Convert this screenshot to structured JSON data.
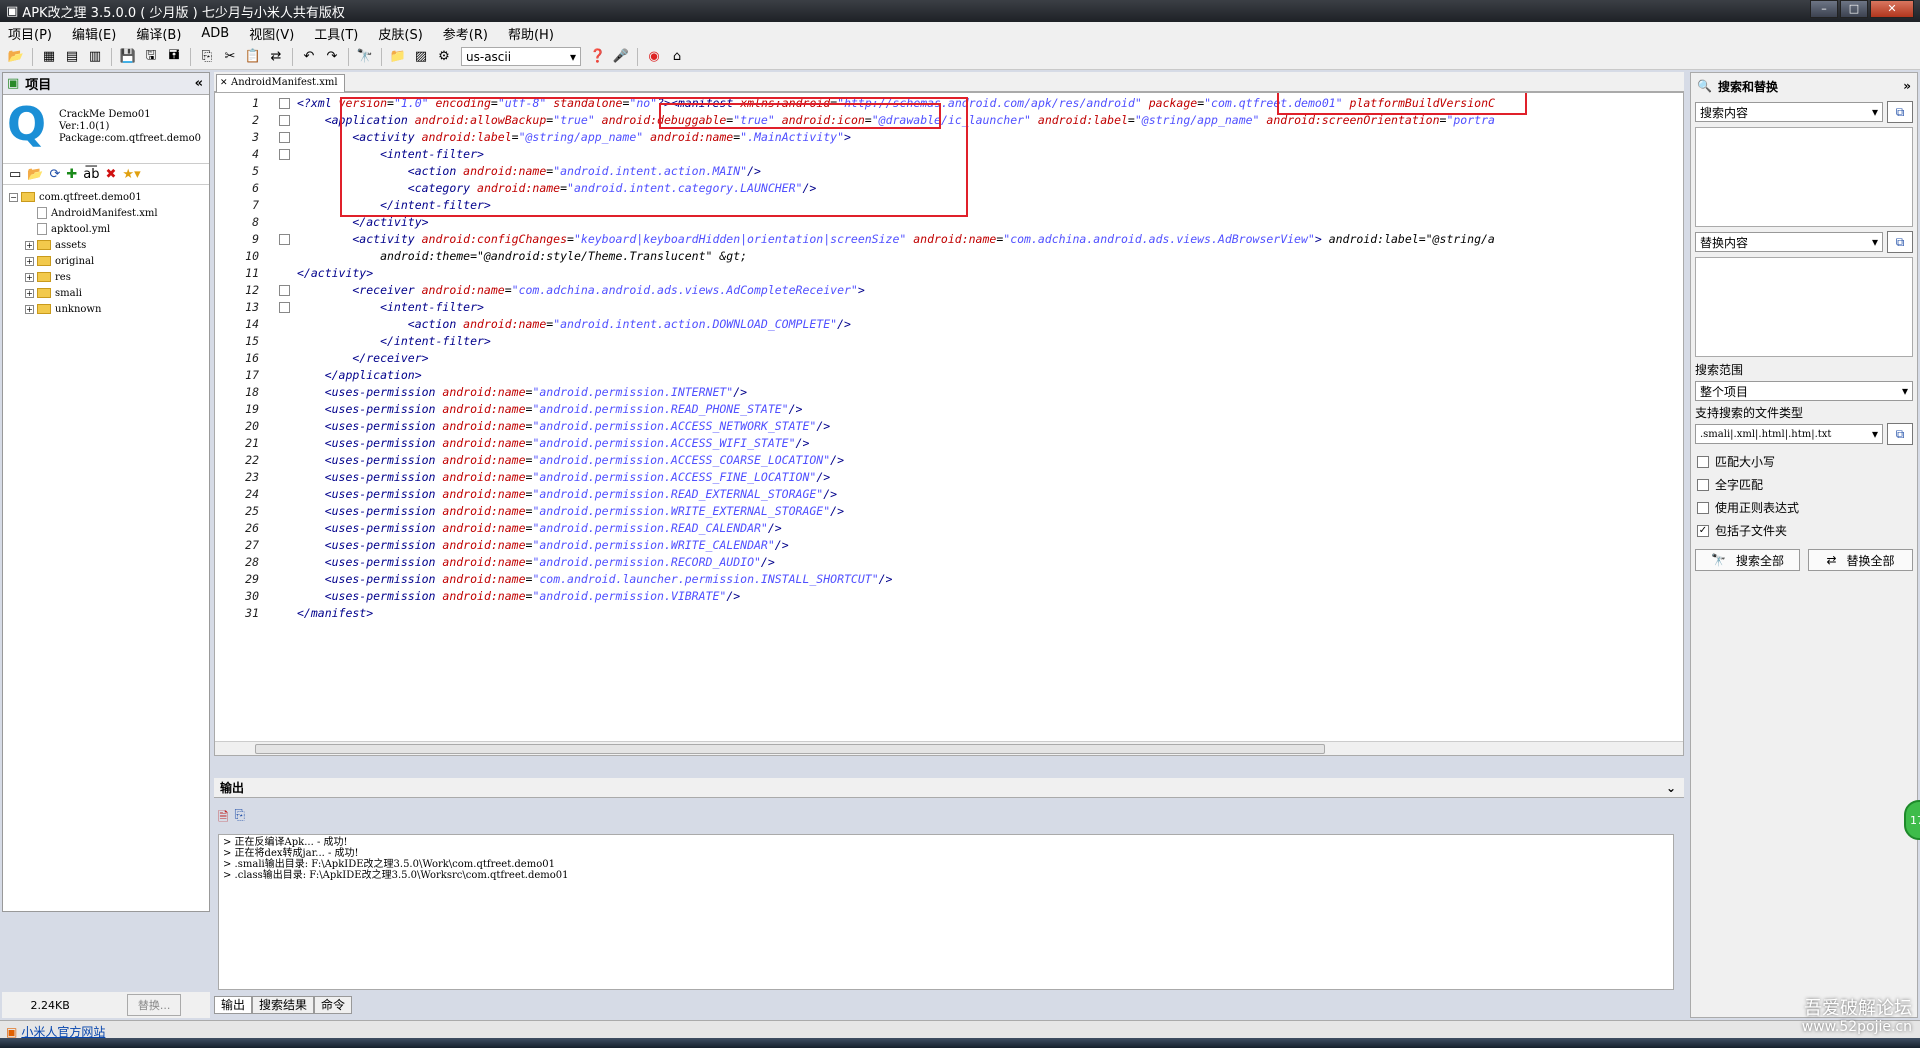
{
  "window": {
    "title": "APK改之理 3.5.0.0 ( 少月版 ) 七少月与小米人共有版权"
  },
  "menu": [
    "项目(P)",
    "编辑(E)",
    "编译(B)",
    "ADB",
    "视图(V)",
    "工具(T)",
    "皮肤(S)",
    "参考(R)",
    "帮助(H)"
  ],
  "toolbar": {
    "encoding": "us-ascii"
  },
  "project_panel": {
    "title": "项目",
    "info": [
      "CrackMe Demo01",
      "Ver:1.0(1)",
      "Package:com.qtfreet.demo0"
    ],
    "tree": [
      {
        "label": "com.qtfreet.demo01",
        "type": "root",
        "level": 0
      },
      {
        "label": "AndroidManifest.xml",
        "type": "file",
        "level": 1
      },
      {
        "label": "apktool.yml",
        "type": "file",
        "level": 1
      },
      {
        "label": "assets",
        "type": "folder",
        "level": 1
      },
      {
        "label": "original",
        "type": "folder",
        "level": 1
      },
      {
        "label": "res",
        "type": "folder",
        "level": 1
      },
      {
        "label": "smali",
        "type": "folder",
        "level": 1
      },
      {
        "label": "unknown",
        "type": "folder",
        "level": 1
      }
    ],
    "size": "2.24KB",
    "replace_button": "替换..."
  },
  "editor": {
    "tab": "AndroidManifest.xml",
    "lines": [
      {
        "n": "1",
        "fold": true,
        "tokens": [
          [
            "tag",
            "<?xml "
          ],
          [
            "attr",
            "version"
          ],
          [
            "plain",
            "="
          ],
          [
            "val",
            "\"1.0\" "
          ],
          [
            "attr",
            "encoding"
          ],
          [
            "plain",
            "="
          ],
          [
            "val",
            "\"utf-8\" "
          ],
          [
            "attr",
            "standalone"
          ],
          [
            "plain",
            "="
          ],
          [
            "val",
            "\"no\""
          ],
          [
            "tag",
            "?><manifest "
          ],
          [
            "attr",
            "xmlns:android"
          ],
          [
            "plain",
            "="
          ],
          [
            "val",
            "\"http://schemas.android.com/apk/res/android\" "
          ],
          [
            "attr",
            "package"
          ],
          [
            "plain",
            "="
          ],
          [
            "val",
            "\"com.qtfreet.demo01\" "
          ],
          [
            "attr",
            "platformBuildVersionC"
          ]
        ]
      },
      {
        "n": "2",
        "fold": true,
        "tokens": [
          [
            "tag",
            "    <application "
          ],
          [
            "attr",
            "android:allowBackup"
          ],
          [
            "plain",
            "="
          ],
          [
            "val",
            "\"true\" "
          ],
          [
            "attr",
            "android:debuggable"
          ],
          [
            "plain",
            "="
          ],
          [
            "val",
            "\"true\" "
          ],
          [
            "attr",
            "android:icon"
          ],
          [
            "plain",
            "="
          ],
          [
            "val",
            "\"@drawable/ic_launcher\" "
          ],
          [
            "attr",
            "android:label"
          ],
          [
            "plain",
            "="
          ],
          [
            "val",
            "\"@string/app_name\" "
          ],
          [
            "attr",
            "android:screenOrientation"
          ],
          [
            "plain",
            "="
          ],
          [
            "val",
            "\"portra"
          ]
        ]
      },
      {
        "n": "3",
        "fold": true,
        "tokens": [
          [
            "tag",
            "        <activity "
          ],
          [
            "attr",
            "android:label"
          ],
          [
            "plain",
            "="
          ],
          [
            "val",
            "\"@string/app_name\" "
          ],
          [
            "attr",
            "android:name"
          ],
          [
            "plain",
            "="
          ],
          [
            "val",
            "\".MainActivity\""
          ],
          [
            "tag",
            ">"
          ]
        ]
      },
      {
        "n": "4",
        "fold": true,
        "tokens": [
          [
            "tag",
            "            <intent-filter>"
          ]
        ]
      },
      {
        "n": "5",
        "fold": false,
        "tokens": [
          [
            "tag",
            "                <action "
          ],
          [
            "attr",
            "android:name"
          ],
          [
            "plain",
            "="
          ],
          [
            "val",
            "\"android.intent.action.MAIN\""
          ],
          [
            "tag",
            "/>"
          ]
        ]
      },
      {
        "n": "6",
        "fold": false,
        "tokens": [
          [
            "tag",
            "                <category "
          ],
          [
            "attr",
            "android:name"
          ],
          [
            "plain",
            "="
          ],
          [
            "val",
            "\"android.intent.category.LAUNCHER\""
          ],
          [
            "tag",
            "/>"
          ]
        ]
      },
      {
        "n": "7",
        "fold": false,
        "tokens": [
          [
            "tag",
            "            </intent-filter>"
          ]
        ]
      },
      {
        "n": "8",
        "fold": false,
        "tokens": [
          [
            "tag",
            "        </activity>"
          ]
        ]
      },
      {
        "n": "9",
        "fold": true,
        "tokens": [
          [
            "tag",
            "        <activity "
          ],
          [
            "attr",
            "android:configChanges"
          ],
          [
            "plain",
            "="
          ],
          [
            "val",
            "\"keyboard|keyboardHidden|orientation|screenSize\" "
          ],
          [
            "attr",
            "android:name"
          ],
          [
            "plain",
            "="
          ],
          [
            "val",
            "\"com.adchina.android.ads.views.AdBrowserView\""
          ],
          [
            "tag",
            "> "
          ],
          [
            "plain",
            "android:label=\"@string/a"
          ]
        ]
      },
      {
        "n": "10",
        "fold": false,
        "tokens": [
          [
            "plain",
            "            android:theme=\"@android:style/Theme.Translucent\" &gt;"
          ]
        ]
      },
      {
        "n": "11",
        "fold": false,
        "tokens": [
          [
            "tag",
            "</activity>"
          ]
        ]
      },
      {
        "n": "12",
        "fold": true,
        "tokens": [
          [
            "tag",
            "        <receiver "
          ],
          [
            "attr",
            "android:name"
          ],
          [
            "plain",
            "="
          ],
          [
            "val",
            "\"com.adchina.android.ads.views.AdCompleteReceiver\""
          ],
          [
            "tag",
            ">"
          ]
        ]
      },
      {
        "n": "13",
        "fold": true,
        "tokens": [
          [
            "tag",
            "            <intent-filter>"
          ]
        ]
      },
      {
        "n": "14",
        "fold": false,
        "tokens": [
          [
            "tag",
            "                <action "
          ],
          [
            "attr",
            "android:name"
          ],
          [
            "plain",
            "="
          ],
          [
            "val",
            "\"android.intent.action.DOWNLOAD_COMPLETE\""
          ],
          [
            "tag",
            "/>"
          ]
        ]
      },
      {
        "n": "15",
        "fold": false,
        "tokens": [
          [
            "tag",
            "            </intent-filter>"
          ]
        ]
      },
      {
        "n": "16",
        "fold": false,
        "tokens": [
          [
            "tag",
            "        </receiver>"
          ]
        ]
      },
      {
        "n": "17",
        "fold": false,
        "tokens": [
          [
            "tag",
            "    </application>"
          ]
        ]
      },
      {
        "n": "18",
        "fold": false,
        "tokens": [
          [
            "tag",
            "    <uses-permission "
          ],
          [
            "attr",
            "android:name"
          ],
          [
            "plain",
            "="
          ],
          [
            "val",
            "\"android.permission.INTERNET\""
          ],
          [
            "tag",
            "/>"
          ]
        ]
      },
      {
        "n": "19",
        "fold": false,
        "tokens": [
          [
            "tag",
            "    <uses-permission "
          ],
          [
            "attr",
            "android:name"
          ],
          [
            "plain",
            "="
          ],
          [
            "val",
            "\"android.permission.READ_PHONE_STATE\""
          ],
          [
            "tag",
            "/>"
          ]
        ]
      },
      {
        "n": "20",
        "fold": false,
        "tokens": [
          [
            "tag",
            "    <uses-permission "
          ],
          [
            "attr",
            "android:name"
          ],
          [
            "plain",
            "="
          ],
          [
            "val",
            "\"android.permission.ACCESS_NETWORK_STATE\""
          ],
          [
            "tag",
            "/>"
          ]
        ]
      },
      {
        "n": "21",
        "fold": false,
        "tokens": [
          [
            "tag",
            "    <uses-permission "
          ],
          [
            "attr",
            "android:name"
          ],
          [
            "plain",
            "="
          ],
          [
            "val",
            "\"android.permission.ACCESS_WIFI_STATE\""
          ],
          [
            "tag",
            "/>"
          ]
        ]
      },
      {
        "n": "22",
        "fold": false,
        "tokens": [
          [
            "tag",
            "    <uses-permission "
          ],
          [
            "attr",
            "android:name"
          ],
          [
            "plain",
            "="
          ],
          [
            "val",
            "\"android.permission.ACCESS_COARSE_LOCATION\""
          ],
          [
            "tag",
            "/>"
          ]
        ]
      },
      {
        "n": "23",
        "fold": false,
        "tokens": [
          [
            "tag",
            "    <uses-permission "
          ],
          [
            "attr",
            "android:name"
          ],
          [
            "plain",
            "="
          ],
          [
            "val",
            "\"android.permission.ACCESS_FINE_LOCATION\""
          ],
          [
            "tag",
            "/>"
          ]
        ]
      },
      {
        "n": "24",
        "fold": false,
        "tokens": [
          [
            "tag",
            "    <uses-permission "
          ],
          [
            "attr",
            "android:name"
          ],
          [
            "plain",
            "="
          ],
          [
            "val",
            "\"android.permission.READ_EXTERNAL_STORAGE\""
          ],
          [
            "tag",
            "/>"
          ]
        ]
      },
      {
        "n": "25",
        "fold": false,
        "tokens": [
          [
            "tag",
            "    <uses-permission "
          ],
          [
            "attr",
            "android:name"
          ],
          [
            "plain",
            "="
          ],
          [
            "val",
            "\"android.permission.WRITE_EXTERNAL_STORAGE\""
          ],
          [
            "tag",
            "/>"
          ]
        ]
      },
      {
        "n": "26",
        "fold": false,
        "tokens": [
          [
            "tag",
            "    <uses-permission "
          ],
          [
            "attr",
            "android:name"
          ],
          [
            "plain",
            "="
          ],
          [
            "val",
            "\"android.permission.READ_CALENDAR\""
          ],
          [
            "tag",
            "/>"
          ]
        ]
      },
      {
        "n": "27",
        "fold": false,
        "tokens": [
          [
            "tag",
            "    <uses-permission "
          ],
          [
            "attr",
            "android:name"
          ],
          [
            "plain",
            "="
          ],
          [
            "val",
            "\"android.permission.WRITE_CALENDAR\""
          ],
          [
            "tag",
            "/>"
          ]
        ]
      },
      {
        "n": "28",
        "fold": false,
        "tokens": [
          [
            "tag",
            "    <uses-permission "
          ],
          [
            "attr",
            "android:name"
          ],
          [
            "plain",
            "="
          ],
          [
            "val",
            "\"android.permission.RECORD_AUDIO\""
          ],
          [
            "tag",
            "/>"
          ]
        ]
      },
      {
        "n": "29",
        "fold": false,
        "tokens": [
          [
            "tag",
            "    <uses-permission "
          ],
          [
            "attr",
            "android:name"
          ],
          [
            "plain",
            "="
          ],
          [
            "val",
            "\"com.android.launcher.permission.INSTALL_SHORTCUT\""
          ],
          [
            "tag",
            "/>"
          ]
        ]
      },
      {
        "n": "30",
        "fold": false,
        "tokens": [
          [
            "tag",
            "    <uses-permission "
          ],
          [
            "attr",
            "android:name"
          ],
          [
            "plain",
            "="
          ],
          [
            "val",
            "\"android.permission.VIBRATE\""
          ],
          [
            "tag",
            "/>"
          ]
        ]
      },
      {
        "n": "31",
        "fold": false,
        "tokens": [
          [
            "tag",
            "</manifest>"
          ]
        ]
      }
    ]
  },
  "output": {
    "title": "输出",
    "lines": [
      "> 正在反编译Apk...  - 成功!",
      "> 正在将dex转成jar...  - 成功!",
      "> .smali输出目录: F:\\ApkIDE改之理3.5.0\\Work\\com.qtfreet.demo01",
      "> .class输出目录: F:\\ApkIDE改之理3.5.0\\Worksrc\\com.qtfreet.demo01"
    ],
    "tabs": [
      "输出",
      "搜索结果",
      "命令"
    ]
  },
  "search_panel": {
    "title": "搜索和替换",
    "search_placeholder": "搜索内容",
    "replace_placeholder": "替换内容",
    "scope_label": "搜索范围",
    "scope_value": "整个项目",
    "filetypes_label": "支持搜索的文件类型",
    "filetypes_value": ".smali|.xml|.html|.htm|.txt",
    "options": [
      {
        "label": "匹配大小写",
        "checked": false
      },
      {
        "label": "全字匹配",
        "checked": false
      },
      {
        "label": "使用正则表达式",
        "checked": false
      },
      {
        "label": "包括子文件夹",
        "checked": true
      }
    ],
    "search_all": "搜索全部",
    "replace_all": "替换全部"
  },
  "statusbar": {
    "link": "小米人官方网站"
  },
  "watermark": [
    "吾爱破解论坛",
    "www.52pojie.cn"
  ],
  "badge": "17",
  "colors": {
    "tag": "#00008b",
    "attr": "#c00000",
    "val": "#5050ff",
    "highlight": "#e0202a"
  }
}
